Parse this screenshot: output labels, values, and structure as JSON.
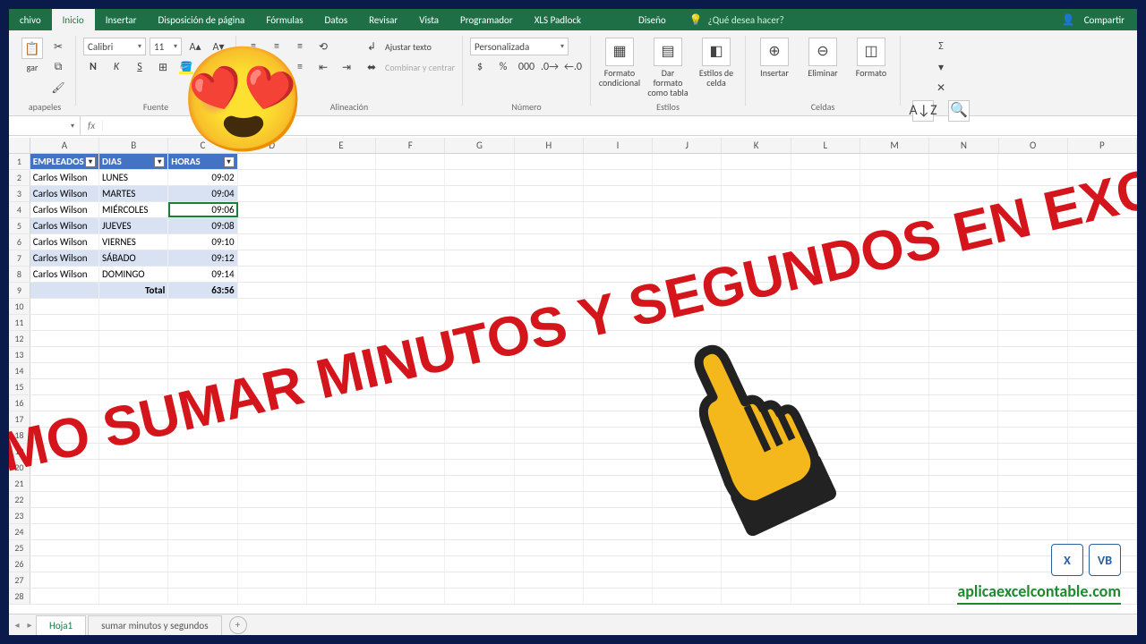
{
  "overlay": {
    "title_text": "COMO SUMAR MINUTOS Y SEGUNDOS EN EXCEL",
    "emoji": "😍",
    "watermark": "aplicaexcelcontable.com",
    "wm_badge1": "X",
    "wm_badge2": "VB"
  },
  "tabs": {
    "file": "chivo",
    "list": [
      "Inicio",
      "Insertar",
      "Disposición de página",
      "Fórmulas",
      "Datos",
      "Revisar",
      "Vista",
      "Programador",
      "XLS Padlock",
      "Diseño"
    ],
    "active_index": 0,
    "tell_me": "¿Qué desea hacer?",
    "share": "Compartir"
  },
  "ribbon": {
    "clipboard_group": "apapeles",
    "paste": "gar",
    "font_group": "Fuente",
    "font_name": "Calibri",
    "font_size": "11",
    "bold": "N",
    "italic": "K",
    "underline": "S",
    "align_group": "Alineación",
    "wrap": "Ajustar texto",
    "merge": "Combinar y centrar",
    "number_group": "Número",
    "number_format": "Personalizada",
    "styles_group": "Estilos",
    "cond_fmt": "Formato condicional",
    "fmt_table": "Dar formato como tabla",
    "cell_styles": "Estilos de celda",
    "cells_group": "Celdas",
    "insert": "Insertar",
    "delete": "Eliminar",
    "format": "Formato",
    "editing_sort": "A↓Z"
  },
  "formula_bar": {
    "name_box": "",
    "fx": "fx",
    "value": ""
  },
  "columns": [
    "A",
    "B",
    "C",
    "D",
    "E",
    "F",
    "G",
    "H",
    "I",
    "J",
    "K",
    "L",
    "M",
    "N",
    "O",
    "P"
  ],
  "table": {
    "headers": [
      "EMPLEADOS",
      "DIAS",
      "HORAS"
    ],
    "rows": [
      {
        "emp": "Carlos Wilson",
        "dia": "LUNES",
        "hr": "09:02"
      },
      {
        "emp": "Carlos Wilson",
        "dia": "MARTES",
        "hr": "09:04"
      },
      {
        "emp": "Carlos Wilson",
        "dia": "MIÉRCOLES",
        "hr": "09:06"
      },
      {
        "emp": "Carlos Wilson",
        "dia": "JUEVES",
        "hr": "09:08"
      },
      {
        "emp": "Carlos Wilson",
        "dia": "VIERNES",
        "hr": "09:10"
      },
      {
        "emp": "Carlos Wilson",
        "dia": "SÁBADO",
        "hr": "09:12"
      },
      {
        "emp": "Carlos Wilson",
        "dia": "DOMINGO",
        "hr": "09:14"
      }
    ],
    "total_label": "Total",
    "total_value": "63:56",
    "selected_row_index": 2
  },
  "sheets": {
    "active": "Hoja1",
    "others": [
      "sumar minutos y segundos"
    ],
    "add": "+"
  }
}
